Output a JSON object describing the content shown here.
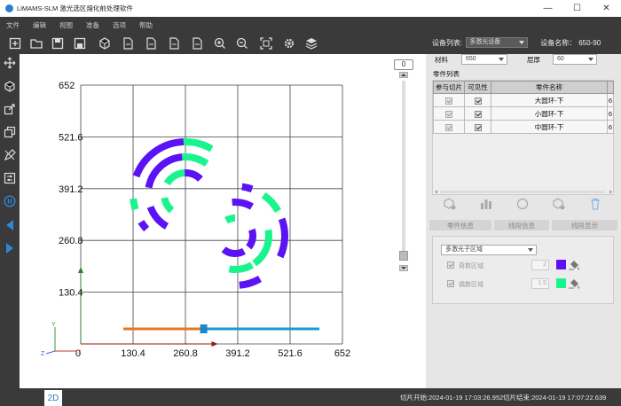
{
  "app": {
    "title": "LiMAMS-SLM 激光选区熔化前处理软件"
  },
  "window_controls": {
    "minimize": "—",
    "maximize": "☐",
    "close": "✕"
  },
  "menu": [
    "文件",
    "编辑",
    "视图",
    "准备",
    "选项",
    "帮助"
  ],
  "device": {
    "list_label": "设备列表:",
    "list_value": "多激光设备",
    "name_label": "设备名称：",
    "name_value": "650-90"
  },
  "toolbar_icons": [
    "new-file-icon",
    "open-folder-icon",
    "save-icon",
    "save-as-icon",
    "add-part-icon",
    "export-icon",
    "export-icon",
    "export-icon",
    "export-icon",
    "zoom-in-icon",
    "zoom-out-icon",
    "fit-view-icon",
    "settings-icon",
    "layers-icon"
  ],
  "left_tools": [
    "move-icon",
    "rotate-icon",
    "scale-icon",
    "copy-icon",
    "edit-icon",
    "adjust-icon",
    "pause-icon",
    "prev-icon",
    "next-icon"
  ],
  "chart_data": {
    "type": "scatter",
    "axis_ticks": [
      "130.4",
      "260.8",
      "391.2",
      "521.6",
      "652"
    ],
    "x_origin_label": "0",
    "xlim": [
      0,
      652
    ],
    "ylim": [
      0,
      652
    ],
    "grid": true,
    "axis_x_color": "#8b1a1a",
    "axis_y_color": "#2e7d32",
    "triad": {
      "x": "x",
      "y": "Y",
      "z": "Z"
    },
    "colors": {
      "odd": "#5b12f5",
      "even": "#19f58c"
    },
    "parts": [
      "大圆环-下",
      "小圆环-下",
      "中圆环-下"
    ]
  },
  "slider": {
    "layer_value": "0",
    "odd_color": "#e87722",
    "even_color": "#1a9ad6",
    "position": 0.41
  },
  "material": {
    "label": "材料",
    "value": "650",
    "layer_label": "层厚",
    "layer_value": "60"
  },
  "parts_list": {
    "title": "零件列表",
    "headers": [
      "参与切片",
      "可见性",
      "零件名称"
    ],
    "extra_col": "6",
    "rows": [
      {
        "name": "大圆环-下",
        "extra": "6"
      },
      {
        "name": "小圆环-下",
        "extra": "6"
      },
      {
        "name": "中圆环-下",
        "extra": "6"
      }
    ]
  },
  "action_icons": [
    "add-part-icon",
    "chart-icon",
    "circle-icon",
    "remove-icon",
    "delete-icon"
  ],
  "tabs": [
    "零件信息",
    "线段信息",
    "线段显示"
  ],
  "region": {
    "select_value": "多激光子区域",
    "odd_label": "奇数区域",
    "odd_value": "2",
    "odd_color": "#5b12f5",
    "even_label": "偶数区域",
    "even_value": "1.5",
    "even_color": "#19f58c"
  },
  "status": {
    "view_tab": "2D",
    "start": "切片开始:2024-01-19 17:03:26.952",
    "end": "切片结束:2024-01-19 17:07:22.639"
  }
}
